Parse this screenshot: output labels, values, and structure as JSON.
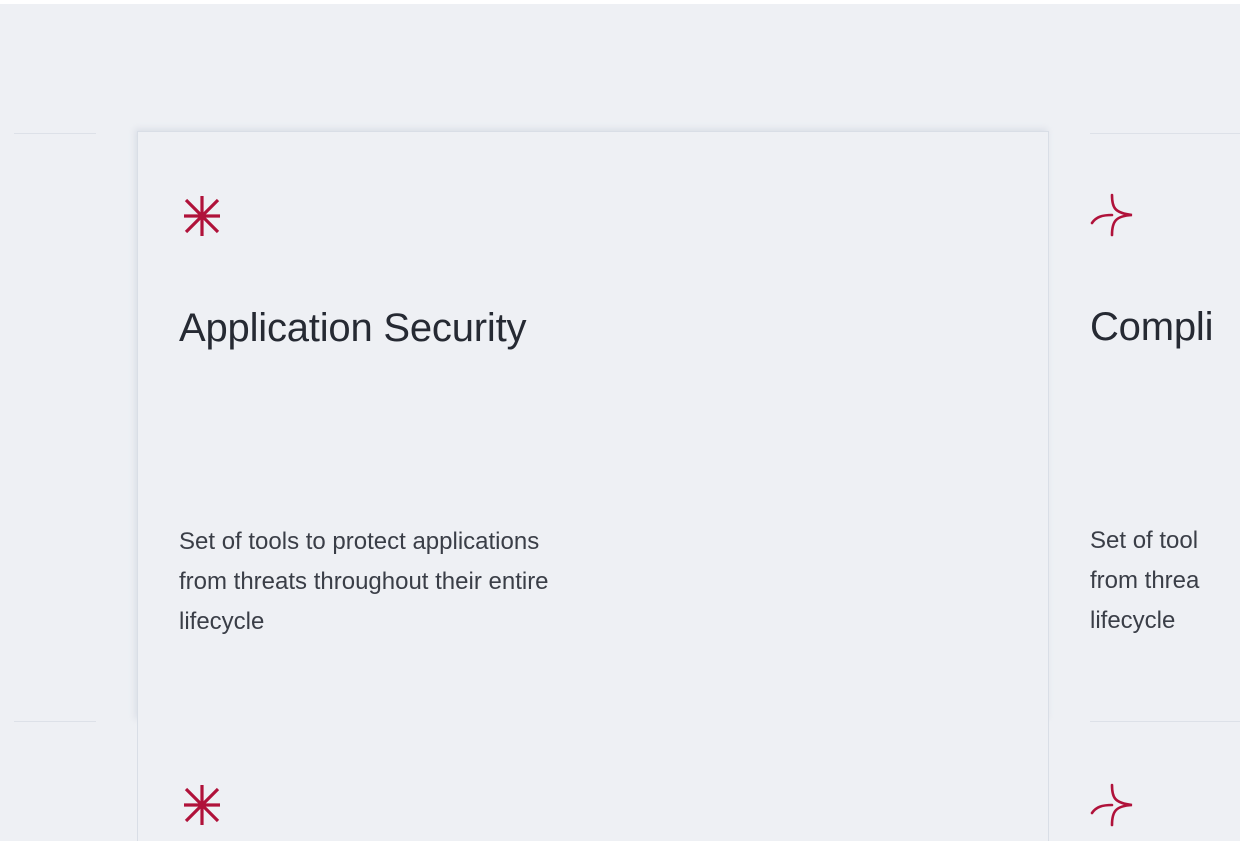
{
  "theme": {
    "accent": "#b0123a",
    "background": "#eef0f4",
    "text": "#262a33"
  },
  "cards": [
    {
      "icon": "asterisk-icon",
      "title": "Application Security",
      "description_lines": [
        "Set of tools to protect applications",
        "from threats throughout their entire",
        "lifecycle"
      ]
    },
    {
      "icon": "sparkle-icon",
      "title": "Compli",
      "description_lines": [
        "Set of tool",
        "from threa",
        "lifecycle"
      ]
    }
  ]
}
